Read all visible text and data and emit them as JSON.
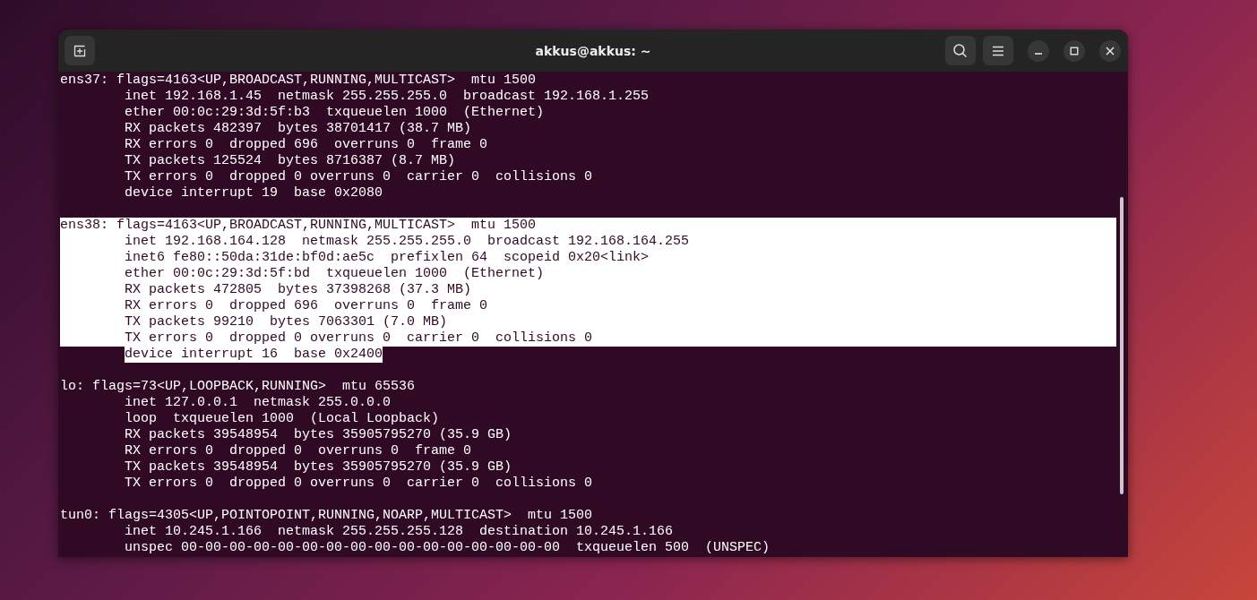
{
  "window": {
    "title": "akkus@akkus: ~"
  },
  "output": [
    {
      "header": {
        "text": "ens37: flags=4163<UP,BROADCAST,RUNNING,MULTICAST>  mtu 1500",
        "selected": false
      },
      "details": [
        {
          "text": "inet 192.168.1.45  netmask 255.255.255.0  broadcast 192.168.1.255",
          "selected": false
        },
        {
          "text": "ether 00:0c:29:3d:5f:b3  txqueuelen 1000  (Ethernet)",
          "selected": false
        },
        {
          "text": "RX packets 482397  bytes 38701417 (38.7 MB)",
          "selected": false
        },
        {
          "text": "RX errors 0  dropped 696  overruns 0  frame 0",
          "selected": false
        },
        {
          "text": "TX packets 125524  bytes 8716387 (8.7 MB)",
          "selected": false
        },
        {
          "text": "TX errors 0  dropped 0 overruns 0  carrier 0  collisions 0",
          "selected": false
        },
        {
          "text": "device interrupt 19  base 0x2080",
          "selected": false
        }
      ]
    },
    {
      "header": {
        "text": "ens38: flags=4163<UP,BROADCAST,RUNNING,MULTICAST>  mtu 1500",
        "selected": true
      },
      "details": [
        {
          "text": "inet 192.168.164.128  netmask 255.255.255.0  broadcast 192.168.164.255",
          "selected": true
        },
        {
          "text": "inet6 fe80::50da:31de:bf0d:ae5c  prefixlen 64  scopeid 0x20<link>",
          "selected": true
        },
        {
          "text": "ether 00:0c:29:3d:5f:bd  txqueuelen 1000  (Ethernet)",
          "selected": true
        },
        {
          "text": "RX packets 472805  bytes 37398268 (37.3 MB)",
          "selected": true
        },
        {
          "text": "RX errors 0  dropped 696  overruns 0  frame 0",
          "selected": true
        },
        {
          "text": "TX packets 99210  bytes 7063301 (7.0 MB)",
          "selected": true
        },
        {
          "text": "TX errors 0  dropped 0 overruns 0  carrier 0  collisions 0",
          "selected": true
        },
        {
          "text": "device interrupt 16  base 0x2400",
          "selected": true
        }
      ]
    },
    {
      "header": {
        "text": "lo: flags=73<UP,LOOPBACK,RUNNING>  mtu 65536",
        "selected": false
      },
      "details": [
        {
          "text": "inet 127.0.0.1  netmask 255.0.0.0",
          "selected": false
        },
        {
          "text": "loop  txqueuelen 1000  (Local Loopback)",
          "selected": false
        },
        {
          "text": "RX packets 39548954  bytes 35905795270 (35.9 GB)",
          "selected": false
        },
        {
          "text": "RX errors 0  dropped 0  overruns 0  frame 0",
          "selected": false
        },
        {
          "text": "TX packets 39548954  bytes 35905795270 (35.9 GB)",
          "selected": false
        },
        {
          "text": "TX errors 0  dropped 0 overruns 0  carrier 0  collisions 0",
          "selected": false
        }
      ]
    },
    {
      "header": {
        "text": "tun0: flags=4305<UP,POINTOPOINT,RUNNING,NOARP,MULTICAST>  mtu 1500",
        "selected": false
      },
      "details": [
        {
          "text": "inet 10.245.1.166  netmask 255.255.255.128  destination 10.245.1.166",
          "selected": false
        },
        {
          "text": "unspec 00-00-00-00-00-00-00-00-00-00-00-00-00-00-00-00  txqueuelen 500  (UNSPEC)",
          "selected": false
        }
      ]
    }
  ]
}
